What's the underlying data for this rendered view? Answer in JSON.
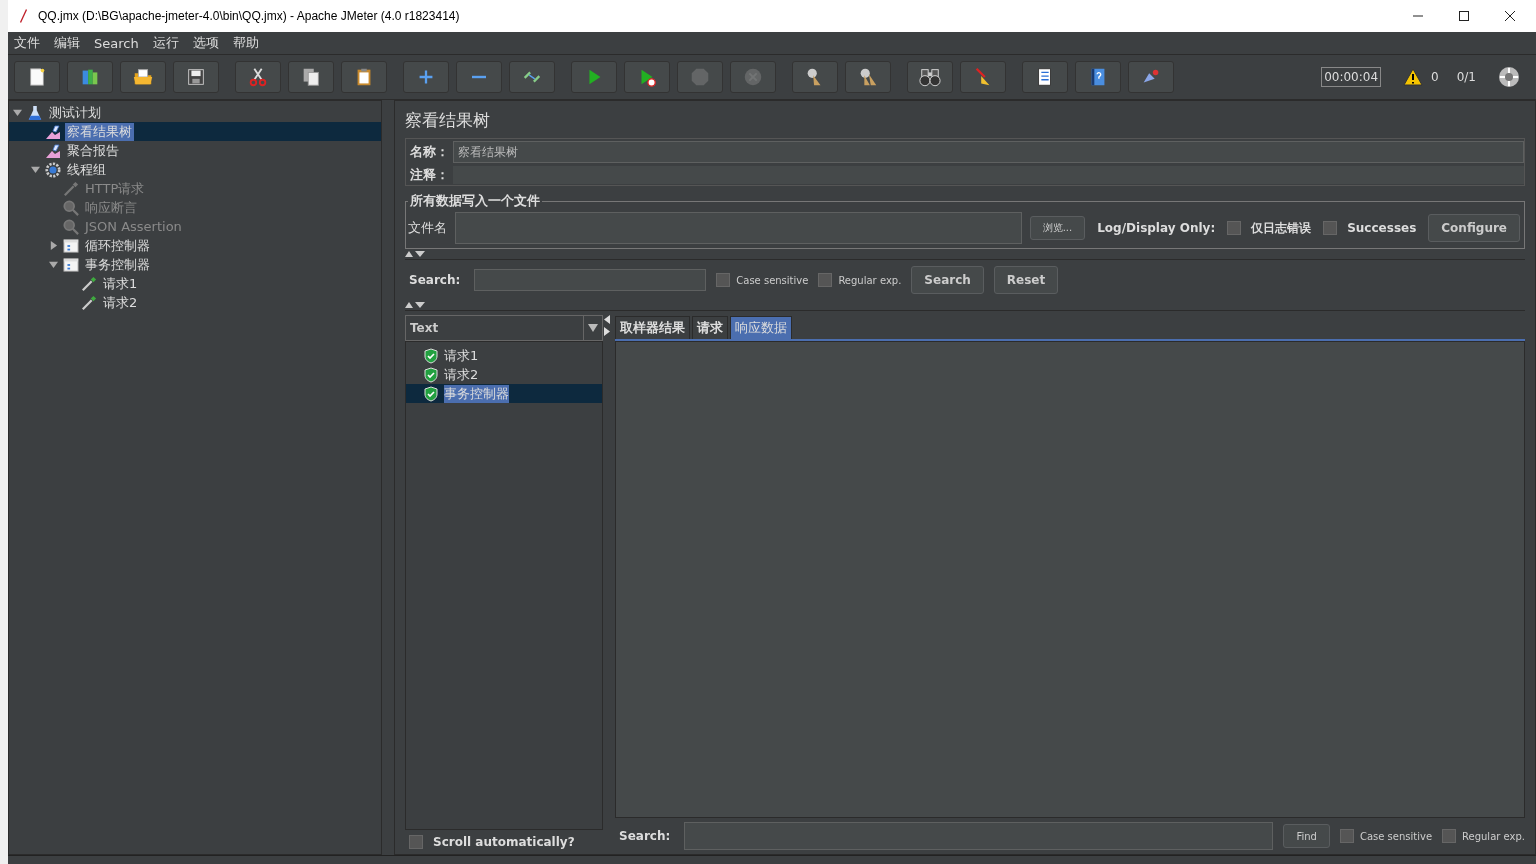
{
  "window": {
    "title": "QQ.jmx (D:\\BG\\apache-jmeter-4.0\\bin\\QQ.jmx) - Apache JMeter (4.0 r1823414)"
  },
  "menu": [
    "文件",
    "编辑",
    "Search",
    "运行",
    "选项",
    "帮助"
  ],
  "toolbar": {
    "groups": [
      [
        {
          "kind": "new",
          "disabled": false
        },
        {
          "kind": "templates",
          "disabled": false
        },
        {
          "kind": "open",
          "disabled": false
        },
        {
          "kind": "save",
          "disabled": false
        }
      ],
      [
        {
          "kind": "cut",
          "disabled": false
        },
        {
          "kind": "copy",
          "disabled": false
        },
        {
          "kind": "paste",
          "disabled": false
        }
      ],
      [
        {
          "kind": "expand",
          "disabled": false
        },
        {
          "kind": "collapse",
          "disabled": false
        },
        {
          "kind": "toggle",
          "disabled": false
        }
      ],
      [
        {
          "kind": "start",
          "disabled": false
        },
        {
          "kind": "start-no-timers",
          "disabled": false
        },
        {
          "kind": "stop",
          "disabled": true
        },
        {
          "kind": "shutdown",
          "disabled": true
        }
      ],
      [
        {
          "kind": "clear",
          "disabled": false
        },
        {
          "kind": "clear-all",
          "disabled": false
        }
      ],
      [
        {
          "kind": "search",
          "disabled": false
        },
        {
          "kind": "reset-search",
          "disabled": false
        }
      ],
      [
        {
          "kind": "functions",
          "disabled": false
        },
        {
          "kind": "help",
          "disabled": false
        },
        {
          "kind": "remote",
          "disabled": false
        }
      ]
    ],
    "timer": "00:00:04",
    "warnings": "0",
    "threads": "0/1"
  },
  "tree": [
    {
      "label": "测试计划",
      "kind": "plan",
      "selected": false,
      "disabled": false,
      "expanded": true,
      "children": [
        {
          "label": "察看结果树",
          "kind": "listener",
          "selected": true,
          "disabled": false
        },
        {
          "label": "聚合报告",
          "kind": "listener",
          "selected": false,
          "disabled": false
        },
        {
          "label": "线程组",
          "kind": "threads",
          "selected": false,
          "disabled": false,
          "expanded": true,
          "children": [
            {
              "label": "HTTP请求",
              "kind": "sampler",
              "selected": false,
              "disabled": true
            },
            {
              "label": "响应断言",
              "kind": "assertion",
              "selected": false,
              "disabled": true
            },
            {
              "label": "JSON Assertion",
              "kind": "assertion",
              "selected": false,
              "disabled": true
            },
            {
              "label": "循环控制器",
              "kind": "controller",
              "selected": false,
              "disabled": false,
              "expanded": false
            },
            {
              "label": "事务控制器",
              "kind": "controller",
              "selected": false,
              "disabled": false,
              "expanded": true,
              "children": [
                {
                  "label": "请求1",
                  "kind": "sampler",
                  "selected": false,
                  "disabled": false
                },
                {
                  "label": "请求2",
                  "kind": "sampler",
                  "selected": false,
                  "disabled": false
                }
              ]
            }
          ]
        }
      ]
    }
  ],
  "panel": {
    "title": "察看结果树",
    "name_label": "名称：",
    "name_value": "察看结果树",
    "comment_label": "注释：",
    "file_group": {
      "legend": "所有数据写入一个文件",
      "filename_label": "文件名",
      "browse": "浏览...",
      "log_label": "Log/Display Only:",
      "options": [
        {
          "label": "仅日志错误",
          "checked": false
        },
        {
          "label": "Successes",
          "checked": false
        }
      ],
      "configure": "Configure"
    },
    "search": {
      "label": "Search:",
      "options": [
        {
          "label": "Case sensitive",
          "checked": false
        },
        {
          "label": "Regular exp.",
          "checked": false
        }
      ],
      "search_button": "Search",
      "reset_button": "Reset"
    },
    "renderer": "Text",
    "results": [
      {
        "label": "请求1",
        "selected": false
      },
      {
        "label": "请求2",
        "selected": false
      },
      {
        "label": "事务控制器",
        "selected": true
      }
    ],
    "scroll": {
      "label": "Scroll automatically?",
      "checked": false
    },
    "tabs": [
      {
        "label": "取样器结果",
        "selected": false
      },
      {
        "label": "请求",
        "selected": false
      },
      {
        "label": "响应数据",
        "selected": true
      }
    ],
    "bottom_search": {
      "label": "Search:",
      "find": "Find",
      "options": [
        {
          "label": "Case sensitive",
          "checked": false
        },
        {
          "label": "Regular exp.",
          "checked": false
        }
      ]
    }
  }
}
